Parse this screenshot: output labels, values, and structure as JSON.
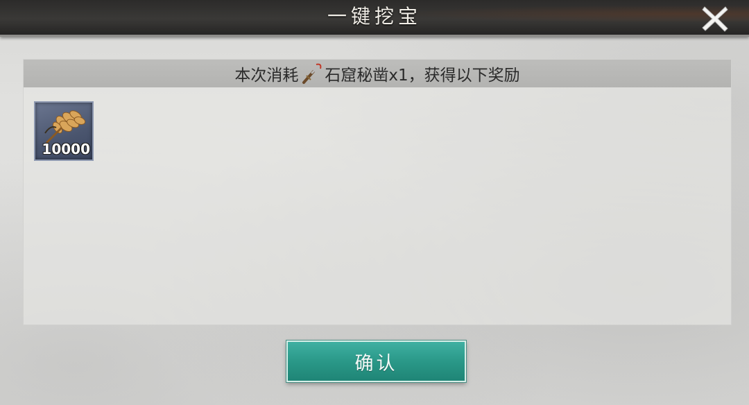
{
  "dialog": {
    "title": "一键挖宝",
    "close_icon": "close-icon"
  },
  "cost_bar": {
    "prefix": "本次消耗",
    "item_icon": "chisel-icon",
    "item_name": "石窟秘凿x1",
    "suffix": "，获得以下奖励"
  },
  "rewards": [
    {
      "icon": "wheat-icon",
      "count": "10000"
    }
  ],
  "confirm_button": {
    "label": "确认"
  },
  "colors": {
    "title_bar": "#2c2b2a",
    "confirm_button": "#2a9888",
    "reward_slot": "#5a6580"
  }
}
